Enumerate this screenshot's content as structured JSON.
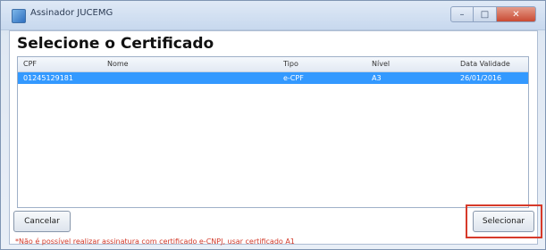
{
  "window": {
    "title": "Assinador JUCEMG",
    "minimize_glyph": "–",
    "maximize_glyph": "□",
    "close_glyph": "✕"
  },
  "dialog": {
    "heading": "Selecione o Certificado"
  },
  "table": {
    "columns": [
      "CPF",
      "Nome",
      "Tipo",
      "Nível",
      "Data Validade"
    ],
    "rows": [
      {
        "cpf": "01245129181",
        "nome": "",
        "tipo": "e-CPF",
        "nivel": "A3",
        "data_validade": "26/01/2016"
      }
    ],
    "selected_row_color": "#3399ff"
  },
  "buttons": {
    "cancel_label": "Cancelar",
    "select_label": "Selecionar"
  },
  "note": {
    "text": "*Não é possível realizar assinatura com certificado e-CNPJ, usar certificado A1",
    "color": "#d23a2a"
  },
  "icons": {
    "app": "signature-app-icon"
  }
}
